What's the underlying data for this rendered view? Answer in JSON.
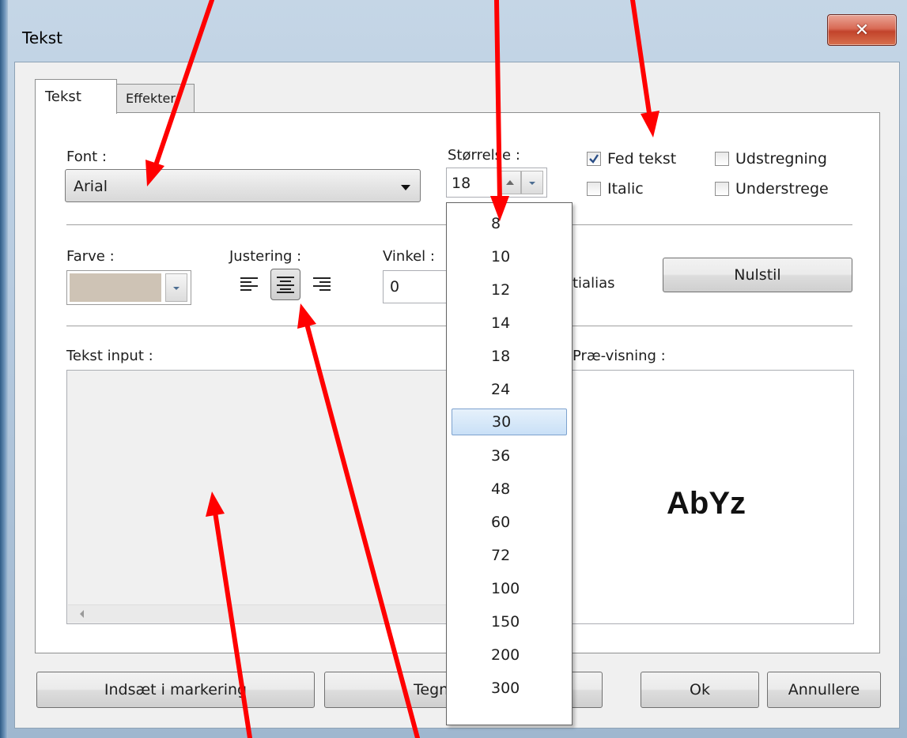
{
  "window": {
    "title": "Tekst",
    "close_glyph": "✕"
  },
  "tabs": [
    {
      "label": "Tekst",
      "active": true
    },
    {
      "label": "Effekter",
      "active": false
    }
  ],
  "font": {
    "label": "Font :",
    "value": "Arial"
  },
  "size": {
    "label": "Størrelse :",
    "value": "18"
  },
  "styles": [
    {
      "label": "Fed tekst",
      "checked": true
    },
    {
      "label": "Udstregning",
      "checked": false
    },
    {
      "label": "Italic",
      "checked": false
    },
    {
      "label": "Understrege",
      "checked": false
    }
  ],
  "color": {
    "label": "Farve :",
    "swatch": "#cec3b5"
  },
  "alignment": {
    "label": "Justering :",
    "options": [
      "left",
      "center",
      "right"
    ],
    "selected": "center"
  },
  "angle": {
    "label": "Vinkel :",
    "value": "0"
  },
  "antialias": {
    "label_visible_fragment": "tialias"
  },
  "reset_button": "Nulstil",
  "text_input": {
    "label": "Tekst input :",
    "value": ""
  },
  "preview": {
    "label": "Præ-visning :",
    "sample": "AbYz"
  },
  "size_dropdown": {
    "options": [
      "8",
      "10",
      "12",
      "14",
      "18",
      "24",
      "30",
      "36",
      "48",
      "60",
      "72",
      "100",
      "150",
      "200",
      "300"
    ],
    "highlighted": "30"
  },
  "buttons": {
    "insert": "Indsæt i markering",
    "draw_visible_fragment": "Tegn",
    "ok": "Ok",
    "cancel": "Annullere"
  },
  "colors": {
    "annotation_arrow": "#ff0000",
    "selection": "#c9e0f7"
  }
}
